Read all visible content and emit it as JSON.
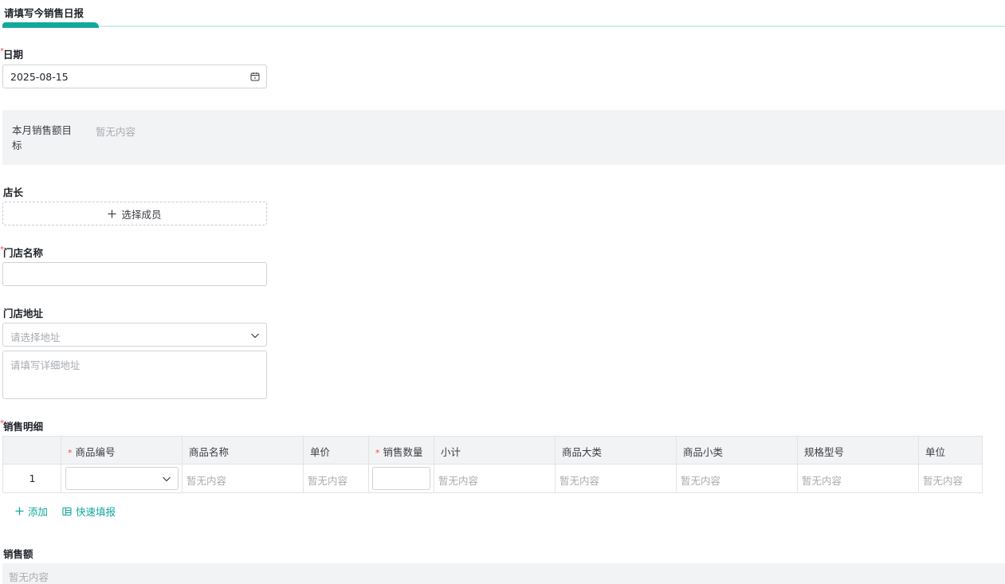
{
  "header": {
    "title": "请填写今销售日报"
  },
  "date_field": {
    "label": "日期",
    "value": "2025-08-15",
    "icon": "calendar-icon"
  },
  "target_field": {
    "label": "本月销售额目标",
    "value": "暂无内容"
  },
  "manager_field": {
    "label": "店长",
    "button_label": "选择成员",
    "icon": "plus-icon"
  },
  "store_name_field": {
    "label": "门店名称",
    "value": ""
  },
  "store_address_field": {
    "label": "门店地址",
    "select_placeholder": "请选择地址",
    "detail_placeholder": "请填写详细地址"
  },
  "sales_detail": {
    "label": "销售明细",
    "columns": [
      {
        "label": "商品编号",
        "required": true
      },
      {
        "label": "商品名称",
        "required": false
      },
      {
        "label": "单价",
        "required": false
      },
      {
        "label": "销售数量",
        "required": true
      },
      {
        "label": "小计",
        "required": false
      },
      {
        "label": "商品大类",
        "required": false
      },
      {
        "label": "商品小类",
        "required": false
      },
      {
        "label": "规格型号",
        "required": false
      },
      {
        "label": "单位",
        "required": false
      }
    ],
    "rows": [
      {
        "index": "1",
        "product_code": "",
        "product_name": "暂无内容",
        "unit_price": "暂无内容",
        "quantity": "",
        "subtotal": "暂无内容",
        "category": "暂无内容",
        "subcategory": "暂无内容",
        "spec": "暂无内容",
        "unit": "暂无内容"
      }
    ],
    "add_label": "添加",
    "quick_fill_label": "快速填报"
  },
  "sales_amount_field": {
    "label": "销售额",
    "value": "暂无内容"
  },
  "colors": {
    "accent": "#13a89e",
    "required": "#f54a45"
  }
}
